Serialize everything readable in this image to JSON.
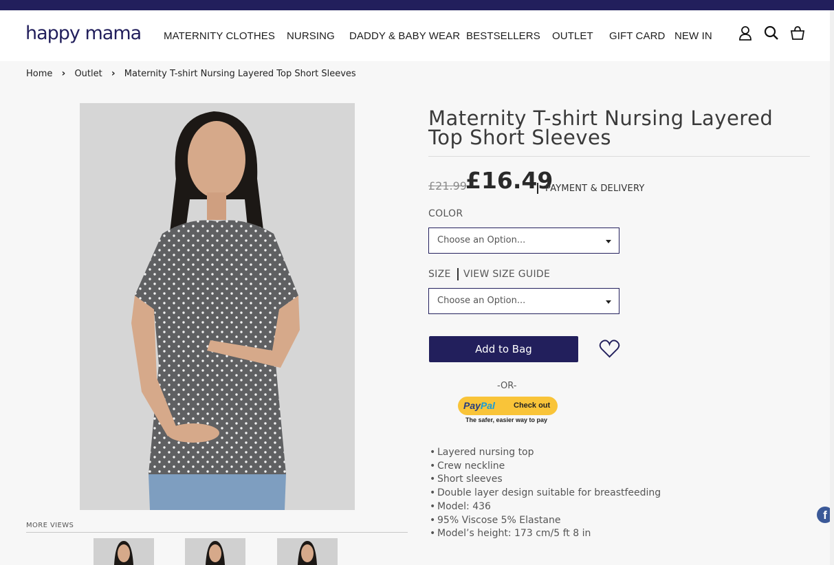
{
  "brand": {
    "logo_text": "happy mama",
    "accent": "#221f5c"
  },
  "nav": {
    "items": [
      {
        "label": "MATERNITY CLOTHES"
      },
      {
        "label": "NURSING"
      },
      {
        "label": "DADDY & BABY WEAR"
      },
      {
        "label": "BESTSELLERS"
      },
      {
        "label": "OUTLET"
      },
      {
        "label": "GIFT CARD"
      },
      {
        "label": "NEW IN"
      }
    ],
    "icons": [
      "user-icon",
      "search-icon",
      "basket-icon"
    ]
  },
  "breadcrumb": {
    "items": [
      "Home",
      "Outlet",
      "Maternity T-shirt Nursing Layered Top Short Sleeves"
    ]
  },
  "gallery": {
    "more_views_label": "MORE VIEWS",
    "main_image_alt": "Model wearing grey polka dot maternity t-shirt",
    "thumbnail_count": 3
  },
  "product": {
    "title": "Maternity T-shirt Nursing Layered Top Short Sleeves",
    "old_price": "£21.99",
    "price": "£16.49",
    "payment_delivery_label": "PAYMENT & DELIVERY",
    "color_label": "COLOR",
    "color_placeholder": "Choose an Option...",
    "size_label": "SIZE",
    "size_guide_label": "VIEW SIZE GUIDE",
    "size_placeholder": "Choose an Option...",
    "add_to_bag_label": "Add to Bag",
    "or_label": "-OR-",
    "paypal": {
      "brand_p": "Pay",
      "brand_pal": "Pal",
      "check_out": "Check out",
      "tagline": "The safer, easier way to pay"
    },
    "features": [
      "Layered nursing top",
      "Crew neckline",
      "Short sleeves",
      "Double layer design suitable for breastfeeding",
      "Model: 436",
      "95% Viscose 5% Elastane",
      "Model’s height: 173 cm/5 ft 8 in"
    ]
  },
  "social": {
    "facebook_glyph": "f"
  }
}
